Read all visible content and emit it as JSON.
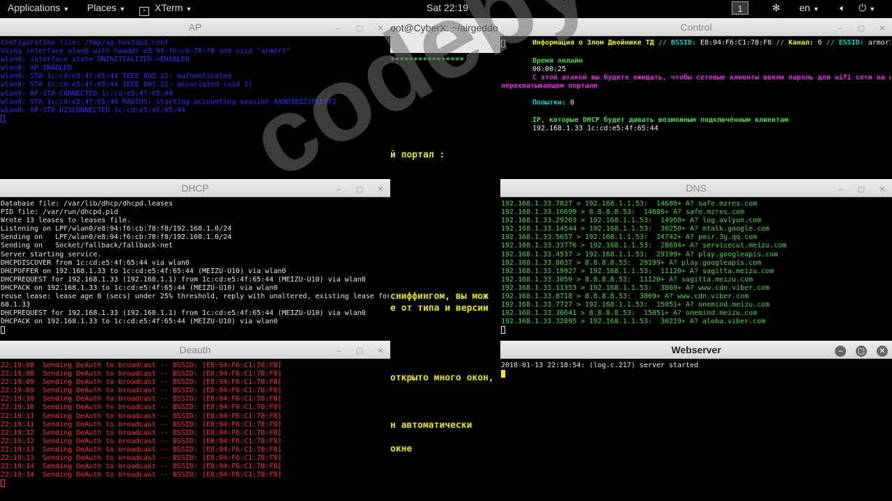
{
  "topbar": {
    "applications": "Applications",
    "places": "Places",
    "xterm": "XTerm",
    "clock": "Sat 22:19",
    "workspace": "1",
    "lang": "en"
  },
  "back_terminal": {
    "title": "oot@CyberX: ~/airgeddo",
    "stars": "****************",
    "lines": [
      "й портал :",
      "сниффингом, вы мож",
      "е от типа и версии",
      "открыто много окон,",
      "н автоматически",
      "окне"
    ]
  },
  "windows": {
    "ap": {
      "title": "AP",
      "lines": [
        "Configuration file: /tmp/ag.hostapd.conf",
        "Using interface wlan0 with hwaddr e8:94:f6:cb:78:f8 and ssid \"armor1\"",
        "wlan0: interface state UNINITIALIZED->ENABLED",
        "wlan0: AP-ENABLED",
        "wlan0: STA 1c:cd:e5:4f:65:44 IEEE 802.11: authenticated",
        "wlan0: STA 1c:cd:e5:4f:65:44 IEEE 802.11: associated (aid 1)",
        "wlan0: AP-STA-CONNECTED 1c:cd:e5:4f:65:44",
        "wlan0: STA 1c:cd:e5:4f:65:44 RADIUS: starting accounting session 4A9D38523F1E4F2",
        "wlan0: AP-STA-DISCONNECTED 1c:cd:e5:4f:65:44"
      ]
    },
    "control": {
      "title": "Control",
      "info_label": "Информация о Злом Двойнике ТД",
      "bssid_label": "BSSID:",
      "bssid_value": "E8:94:F6:C1:78:F8",
      "channel_label": "Канал:",
      "channel_value": "6",
      "essid_label": "ESSID:",
      "essid_value": "armor1",
      "time_label": "Время онлайн",
      "time_value": "00:00:25",
      "wait_text_1": "С этой атакой вы будете ожидать, чтобы сетевые клиенты ввели пароль для wifi сети на нашем",
      "wait_text_2": "перехватывающем портале",
      "attempts_label": "Попытки:",
      "attempts_value": "0",
      "dhcp_label": "IP, которые DHCP будет давать возможным подключённым клиентам",
      "client": "192.168.1.33 1c:cd:e5:4f:65:44"
    },
    "dhcp": {
      "title": "DHCP",
      "lines": [
        "Database file: /var/lib/dhcp/dhcpd.leases",
        "PID file: /var/run/dhcpd.pid",
        "Wrote 13 leases to leases file.",
        "Listening on LPF/wlan0/e8:94:f6:cb:78:f8/192.168.1.0/24",
        "Sending on   LPF/wlan0/e8:94:f6:cb:78:f8/192.168.1.0/24",
        "Sending on   Socket/fallback/fallback-net",
        "Server starting service.",
        "DHCPDISCOVER from 1c:cd:e5:4f:65:44 via wlan0",
        "DHCPOFFER on 192.168.1.33 to 1c:cd:e5:4f:65:44 (MEIZU-U10) via wlan0",
        "DHCPREQUEST for 192.168.1.33 (192.168.1.1) from 1c:cd:e5:4f:65:44 (MEIZU-U10) via wlan0",
        "DHCPACK on 192.168.1.33 to 1c:cd:e5:4f:65:44 (MEIZU-U10) via wlan0",
        "reuse_lease: lease age 0 (secs) under 25% threshold, reply with unaltered, existing lease for 192.1",
        "68.1.33",
        "DHCPREQUEST for 192.168.1.33 (192.168.1.1) from 1c:cd:e5:4f:65:44 (MEIZU-U10) via wlan0",
        "DHCPACK on 192.168.1.33 to 1c:cd:e5:4f:65:44 (MEIZU-U10) via wlan0"
      ]
    },
    "dns": {
      "title": "DNS",
      "lines": [
        "192.168.1.33.7827 > 192.168.1.1.53:  14686+ A? safe.mzres.com",
        "192.168.1.33.16699 > 8.8.8.8.53:  14686+ A? safe.mzres.com",
        "192.168.1.33.29203 > 192.168.1.1.53:  14958+ A? log.avlyun.com",
        "192.168.1.33.14544 > 192.168.1.1.53:  30250+ A? mtalk.google.com",
        "192.168.1.33.5657 > 192.168.1.1.53:  24742+ A? pmir.3g.qq.com",
        "192.168.1.33.33776 > 192.168.1.1.53:  28694+ A? servicecut.meizu.com",
        "192.168.1.33.4537 > 192.168.1.1.53:  29199+ A? play.googleapis.com",
        "192.168.1.33.8037 > 8.8.8.8.53:  29199+ A? play.googleapis.com",
        "192.168.1.33.19927 > 192.168.1.1.53:  11120+ A? sagitta.meizu.com",
        "192.168.1.33.3059 > 8.8.8.8.53:  11120+ A? sagitta.meizu.com",
        "192.168.1.33.11353 > 192.168.1.1.53:  3869+ A? www.cdn.viber.com",
        "192.168.1.33.8718 > 8.8.8.8.53:  3869+ A? www.cdn.viber.com",
        "192.168.1.33.7727 > 192.168.1.1.53:  15051+ A? onemind.meizu.com",
        "192.168.1.33.30641 > 8.8.8.8.53:  15051+ A? onemind.meizu.com",
        "192.168.1.33.32895 > 192.168.1.1.53:  30219+ A? aloha.viber.com"
      ]
    },
    "deauth": {
      "title": "Deauth",
      "lines": [
        "22:19:08  Sending DeAuth to broadcast -- BSSID: [E8:94:F6:C1:78:F8]",
        "22:19:08  Sending DeAuth to broadcast -- BSSID: [E8:94:F6:C1:78:F8]",
        "22:19:09  Sending DeAuth to broadcast -- BSSID: [E8:94:F6:C1:78:F8]",
        "22:19:09  Sending DeAuth to broadcast -- BSSID: [E8:94:F6:C1:78:F8]",
        "22:19:10  Sending DeAuth to broadcast -- BSSID: [E8:94:F6:C1:78:F8]",
        "22:19:10  Sending DeAuth to broadcast -- BSSID: [E8:94:F6:C1:78:F8]",
        "22:19:11  Sending DeAuth to broadcast -- BSSID: [E8:94:F6:C1:78:F8]",
        "22:19:11  Sending DeAuth to broadcast -- BSSID: [E8:94:F6:C1:78:F8]",
        "22:19:12  Sending DeAuth to broadcast -- BSSID: [E8:94:F6:C1:78:F8]",
        "22:19:12  Sending DeAuth to broadcast -- BSSID: [E8:94:F6:C1:78:F8]",
        "22:19:13  Sending DeAuth to broadcast -- BSSID: [E8:94:F6:C1:78:F8]",
        "22:19:13  Sending DeAuth to broadcast -- BSSID: [E8:94:F6:C1:78:F8]",
        "22:19:14  Sending DeAuth to broadcast -- BSSID: [E8:94:F6:C1:78:F8]",
        "22:19:14  Sending DeAuth to broadcast -- BSSID: [E8:94:F6:C1:78:F8]"
      ]
    },
    "webserver": {
      "title": "Webserver",
      "lines": [
        "2018-01-13 22:18:54: (log.c.217) server started"
      ]
    }
  },
  "watermark": "codeby.net",
  "colors": {
    "ap_text": "#3030ff",
    "dns_text": "#46d846",
    "deauth_text": "#ff3030",
    "dhcp_text": "#e6e6e6"
  }
}
